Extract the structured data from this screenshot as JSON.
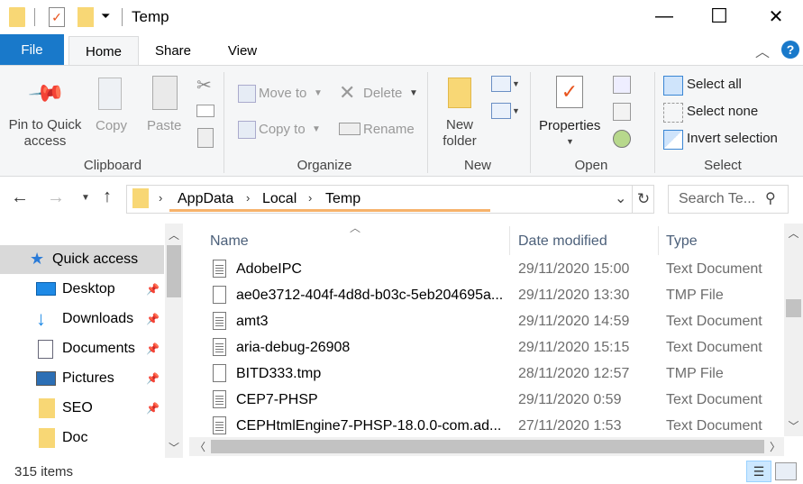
{
  "window": {
    "title": "Temp",
    "minimize_glyph": "—",
    "maximize_glyph": "☐",
    "close_glyph": "✕"
  },
  "ribbon_tabs": [
    "File",
    "Home",
    "Share",
    "View"
  ],
  "ribbon": {
    "clipboard": {
      "pin_label_1": "Pin to Quick",
      "pin_label_2": "access",
      "copy": "Copy",
      "paste": "Paste",
      "group": "Clipboard"
    },
    "organize": {
      "move_to": "Move to",
      "copy_to": "Copy to",
      "delete": "Delete",
      "rename": "Rename",
      "group": "Organize"
    },
    "new": {
      "new_folder_1": "New",
      "new_folder_2": "folder",
      "group": "New"
    },
    "open": {
      "properties": "Properties",
      "group": "Open"
    },
    "select": {
      "select_all": "Select all",
      "select_none": "Select none",
      "invert": "Invert selection",
      "group": "Select"
    }
  },
  "address": {
    "crumbs": [
      "AppData",
      "Local",
      "Temp"
    ],
    "search_placeholder": "Search Te..."
  },
  "nav": {
    "items": [
      {
        "label": "Quick access",
        "icon": "star-icon"
      },
      {
        "label": "Desktop",
        "icon": "desktop-icon"
      },
      {
        "label": "Downloads",
        "icon": "download-icon"
      },
      {
        "label": "Documents",
        "icon": "documents-icon"
      },
      {
        "label": "Pictures",
        "icon": "pictures-icon"
      },
      {
        "label": "SEO",
        "icon": "folder-icon"
      },
      {
        "label": "Doc",
        "icon": "folder-icon"
      }
    ]
  },
  "files": {
    "columns": [
      "Name",
      "Date modified",
      "Type"
    ],
    "rows": [
      {
        "name": "AdobeIPC",
        "date": "29/11/2020 15:00",
        "type": "Text Document"
      },
      {
        "name": "ae0e3712-404f-4d8d-b03c-5eb204695a...",
        "date": "29/11/2020 13:30",
        "type": "TMP File"
      },
      {
        "name": "amt3",
        "date": "29/11/2020 14:59",
        "type": "Text Document"
      },
      {
        "name": "aria-debug-26908",
        "date": "29/11/2020 15:15",
        "type": "Text Document"
      },
      {
        "name": "BITD333.tmp",
        "date": "28/11/2020 12:57",
        "type": "TMP File"
      },
      {
        "name": "CEP7-PHSP",
        "date": "29/11/2020 0:59",
        "type": "Text Document"
      },
      {
        "name": "CEPHtmlEngine7-PHSP-18.0.0-com.ad...",
        "date": "27/11/2020 1:53",
        "type": "Text Document"
      }
    ]
  },
  "status": {
    "item_count": "315 items"
  },
  "colors": {
    "accent": "#1979ca",
    "folder": "#f8d775",
    "select_highlight": "#cce8ff"
  }
}
